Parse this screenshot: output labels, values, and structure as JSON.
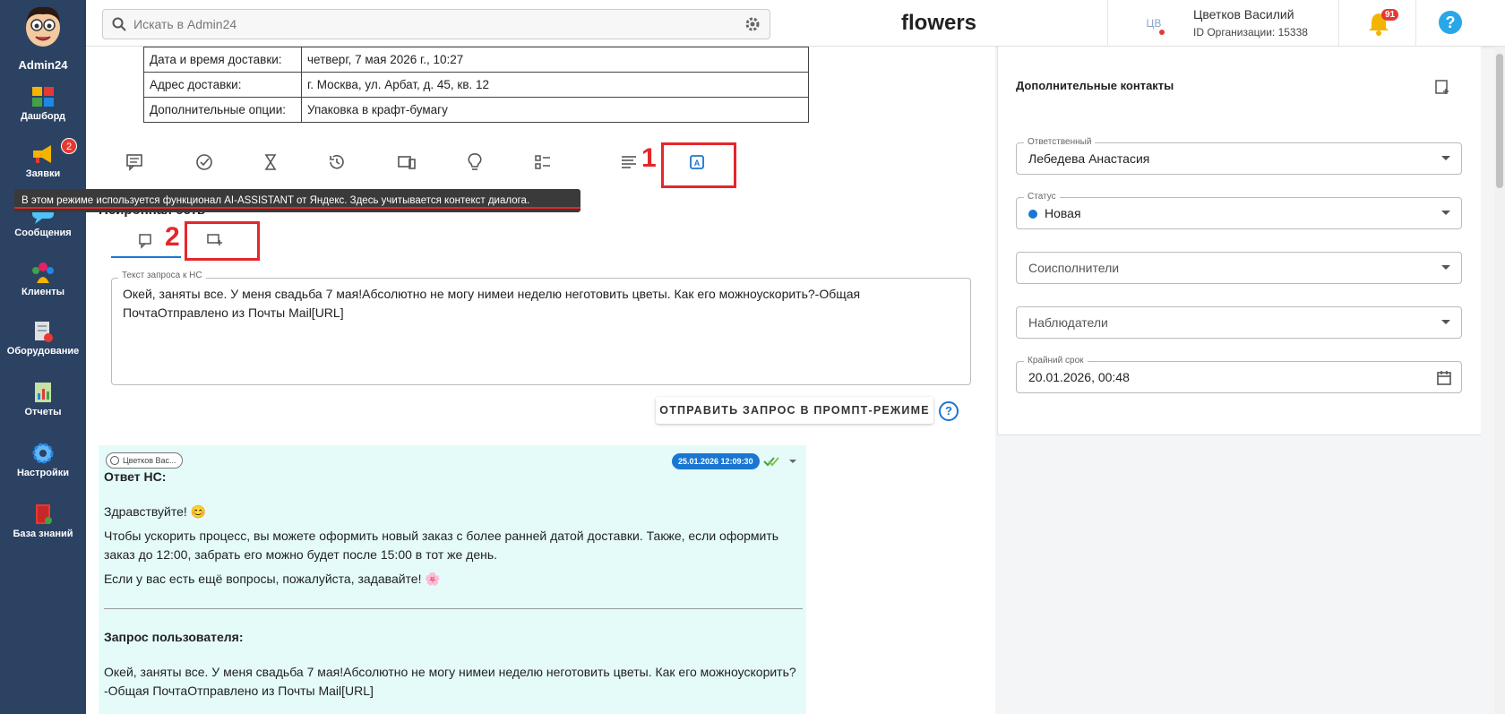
{
  "sidebar": {
    "logo_label": "Admin24",
    "items": [
      {
        "label": "Дашборд",
        "icon": "dashboard-icon"
      },
      {
        "label": "Заявки",
        "icon": "megaphone-icon",
        "badge": "2"
      },
      {
        "label": "Сообщения",
        "icon": "chat-icon"
      },
      {
        "label": "Клиенты",
        "icon": "clients-icon"
      },
      {
        "label": "Оборудование",
        "icon": "equipment-icon"
      },
      {
        "label": "Отчеты",
        "icon": "reports-icon"
      },
      {
        "label": "Настройки",
        "icon": "gear-icon"
      },
      {
        "label": "База знаний",
        "icon": "book-icon"
      }
    ]
  },
  "topbar": {
    "search_placeholder": "Искать в Admin24",
    "brand": "flowers",
    "user_initials": "ЦВ",
    "user_name": "Цветков Василий",
    "org_id": "ID Организации: 15338",
    "notifications_count": "91",
    "help_label": "?"
  },
  "order_info": [
    {
      "key": "Дата и время доставки:",
      "value": "четверг, 7 мая 2026 г., 10:27"
    },
    {
      "key": "Адрес доставки:",
      "value": "г. Москва, ул. Арбат, д. 45, кв. 12"
    },
    {
      "key": "Дополнительные опции:",
      "value": "Упаковка в крафт-бумагу"
    }
  ],
  "annotations": {
    "one": "1",
    "two": "2"
  },
  "tooltip": "В этом режиме используется функционал AI-ASSISTANT от Яндекс. Здесь учитывается контекст диалога.",
  "section_title": "Нейронная сеть",
  "request": {
    "legend": "Текст запроса к НС",
    "text": "Окей, заняты все. У меня свадьба 7 мая!Абсолютно не могу нимеи неделю неготовить цветы. Как его можноускорить?-Общая ПочтаОтправлено из Почты Mail[URL]",
    "send_button": "ОТПРАВИТЬ ЗАПРОС В ПРОМПТ-РЕЖИМЕ",
    "help": "?"
  },
  "answer": {
    "author_chip": "Цветков Вас...",
    "timestamp": "25.01.2026 12:09:30",
    "title": "Ответ НС:",
    "greeting": "Здравствуйте! 😊",
    "body1": "Чтобы ускорить процесс, вы можете оформить новый заказ с более ранней датой доставки. Также, если оформить заказ до 12:00, забрать его можно будет после 15:00 в тот же день.",
    "body2": "Если у вас есть ещё вопросы, пожалуйста, задавайте! 🌸",
    "user_request_title": "Запрос пользователя:",
    "user_request_text": "Окей, заняты все. У меня свадьба 7 мая!Абсолютно не могу нимеи неделю неготовить цветы. Как его можноускорить?-Общая ПочтаОтправлено из Почты Mail[URL]"
  },
  "right_panel": {
    "contacts_title": "Дополнительные контакты",
    "responsible_legend": "Ответственный",
    "responsible_value": "Лебедева Анастасия",
    "status_legend": "Статус",
    "status_value": "Новая",
    "coexecutors_placeholder": "Соисполнители",
    "observers_placeholder": "Наблюдатели",
    "deadline_legend": "Крайний срок",
    "deadline_value": "20.01.2026, 00:48"
  },
  "colors": {
    "sidebar": "#2b4263",
    "accent": "#1976d2",
    "highlight": "#e5262a",
    "answer_bg": "#e4fbfa"
  }
}
